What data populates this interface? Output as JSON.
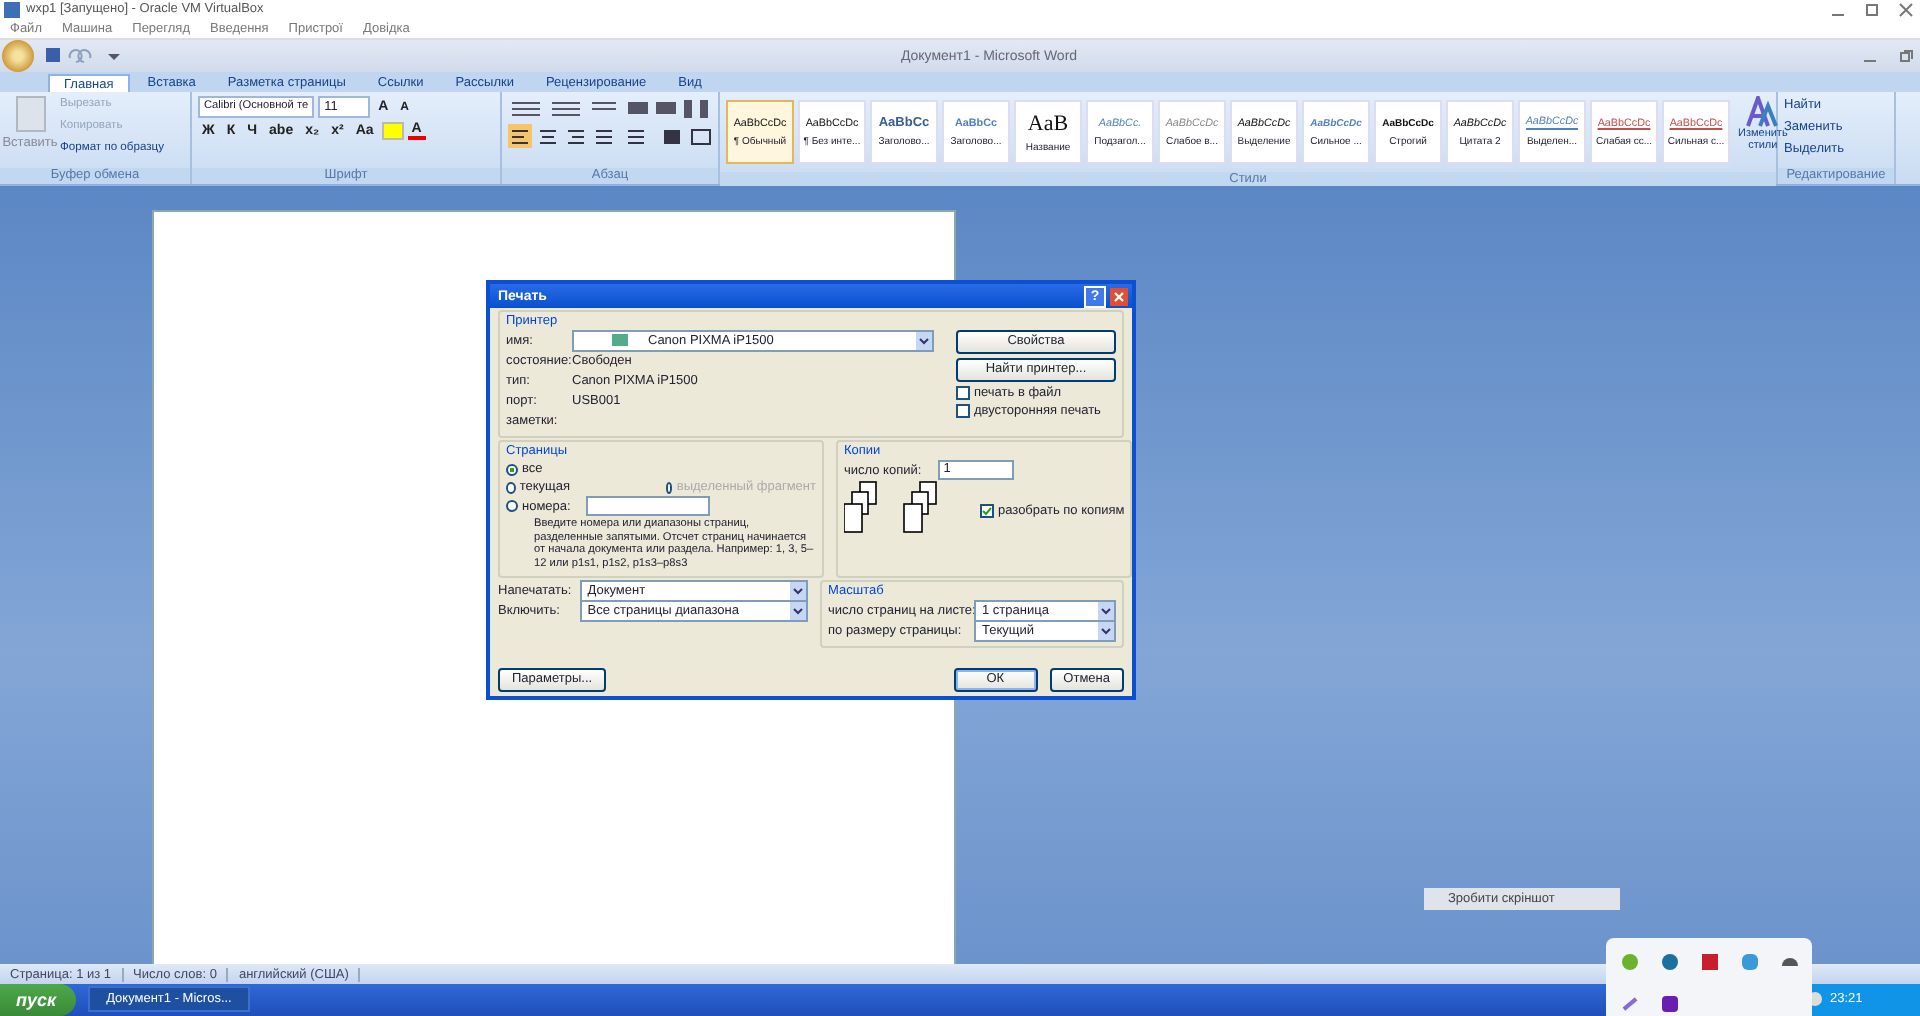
{
  "vbox": {
    "title": "wxp1 [Запущено] - Oracle VM VirtualBox",
    "menu": [
      "Файл",
      "Машина",
      "Перегляд",
      "Введення",
      "Пристрої",
      "Довідка"
    ]
  },
  "word": {
    "title": "Документ1 - Microsoft Word",
    "tabs": [
      {
        "label": "Главная",
        "selected": true
      },
      {
        "label": "Вставка",
        "selected": false
      },
      {
        "label": "Разметка страницы",
        "selected": false
      },
      {
        "label": "Ссылки",
        "selected": false
      },
      {
        "label": "Рассылки",
        "selected": false
      },
      {
        "label": "Рецензирование",
        "selected": false
      },
      {
        "label": "Вид",
        "selected": false
      }
    ],
    "clipboard": {
      "paste": "Вставить",
      "items": [
        "Вырезать",
        "Копировать",
        "Формат по образцу"
      ],
      "label": "Буфер обмена"
    },
    "font": {
      "name": "Calibri (Основной те",
      "size": "11",
      "grow": "A",
      "shrink": "A",
      "buttons": [
        "Ж",
        "К",
        "Ч",
        "abe",
        "x₂",
        "x²",
        "Aa"
      ],
      "color_button": "A",
      "label": "Шрифт"
    },
    "paragraph": {
      "label": "Абзац"
    },
    "styles": {
      "items": [
        {
          "sample": "AaBbCcDc",
          "name": "¶ Обычный",
          "kind": "plain",
          "selected": true
        },
        {
          "sample": "AaBbCcDc",
          "name": "¶ Без инте...",
          "kind": "plain",
          "selected": false
        },
        {
          "sample": "AaBbCc",
          "name": "Заголово...",
          "kind": "heading",
          "selected": false
        },
        {
          "sample": "AaBbCc",
          "name": "Заголово...",
          "kind": "heading2",
          "selected": false
        },
        {
          "sample": "AaB",
          "name": "Название",
          "kind": "title",
          "selected": false
        },
        {
          "sample": "AaBbCc.",
          "name": "Подзагол...",
          "kind": "subtitle",
          "selected": false
        },
        {
          "sample": "AaBbCcDc",
          "name": "Слабое в...",
          "kind": "subtle",
          "selected": false
        },
        {
          "sample": "AaBbCcDc",
          "name": "Выделение",
          "kind": "italic",
          "selected": false
        },
        {
          "sample": "AaBbCcDc",
          "name": "Сильное ...",
          "kind": "accent",
          "selected": false
        },
        {
          "sample": "AaBbCcDc",
          "name": "Строгий",
          "kind": "bold",
          "selected": false
        },
        {
          "sample": "AaBbCcDc",
          "name": "Цитата 2",
          "kind": "italic",
          "selected": false
        },
        {
          "sample": "AaBbCcDc",
          "name": "Выделен...",
          "kind": "quote",
          "selected": false
        },
        {
          "sample": "AaBbCcDc",
          "name": "Слабая сс...",
          "kind": "reference",
          "selected": false
        },
        {
          "sample": "AaBbCcDc",
          "name": "Сильная с...",
          "kind": "reference",
          "selected": false
        }
      ],
      "change": "Изменить стили",
      "label": "Стили"
    },
    "editing": {
      "items": [
        "Найти",
        "Заменить",
        "Выделить"
      ],
      "label": "Редактирование"
    }
  },
  "dialog": {
    "title": "Печать",
    "help": "?",
    "printer": {
      "label": "Принтер",
      "fields": [
        {
          "label": "имя:",
          "value": "Canon PIXMA iP1500"
        },
        {
          "label": "состояние:",
          "value": "Свободен"
        },
        {
          "label": "тип:",
          "value": "Canon PIXMA iP1500"
        },
        {
          "label": "порт:",
          "value": "USB001"
        },
        {
          "label": "заметки:"
        }
      ],
      "properties": "Свойства",
      "find": "Найти принтер...",
      "checks": [
        {
          "label": "печать в файл",
          "checked": false
        },
        {
          "label": "двусторонняя печать",
          "checked": false
        }
      ]
    },
    "pages": {
      "label": "Страницы",
      "options": [
        {
          "label": "все",
          "selected": true
        },
        {
          "label": "текущая",
          "selected": false
        },
        {
          "label": "номера:",
          "selected": false
        }
      ],
      "selection": {
        "label": "выделенный фрагмент",
        "disabled": true
      },
      "hint": "Введите номера или диапазоны страниц, разделенные запятыми. Отсчет страниц начинается от начала документа или раздела. Например: 1, 3, 5–12 или p1s1, p1s2, p1s3–p8s3"
    },
    "copies": {
      "label": "Копии",
      "count_label": "число копий:",
      "count": "1",
      "collate": {
        "label": "разобрать по копиям",
        "checked": true
      }
    },
    "print_what": {
      "label": "Напечатать:",
      "value": "Документ"
    },
    "include": {
      "label": "Включить:",
      "value": "Все страницы диапазона"
    },
    "zoom": {
      "label": "Масштаб",
      "rows": [
        {
          "label": "число страниц на листе:",
          "value": "1 страница"
        },
        {
          "label": "по размеру страницы:",
          "value": "Текущий"
        }
      ]
    },
    "buttons": {
      "options": "Параметры...",
      "ok": "ОК",
      "cancel": "Отмена"
    }
  },
  "status_bar": [
    "Страница: 1 из 1",
    "Число слов: 0",
    "английский (США)"
  ],
  "screenshot_tip": "Зробити скріншот",
  "taskbar": {
    "start": "пуск",
    "task": "Документ1 - Micros...",
    "time": "23:21"
  }
}
